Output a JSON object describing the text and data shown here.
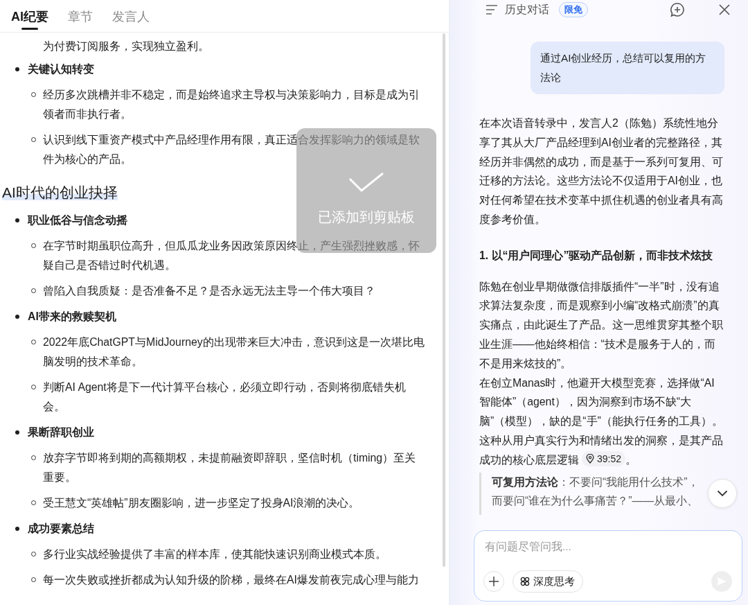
{
  "tabs": [
    {
      "label": "AI纪要",
      "selected": true
    },
    {
      "label": "章节",
      "selected": false
    },
    {
      "label": "发言人",
      "selected": false
    }
  ],
  "summary": [
    {
      "kind": "continuation",
      "text": "为付费订阅服务，实现独立盈利。"
    },
    {
      "kind": "bullet",
      "text": "关键认知转变",
      "children": [
        {
          "text": "经历多次跳槽并非不稳定，而是始终追求主导权与决策影响力，目标是成为引领者而非执行者。"
        },
        {
          "text": "认识到线下重资产模式中产品经理作用有限，真正适合发挥影响力的领域是软件为核心的产品。"
        }
      ]
    },
    {
      "kind": "heading",
      "text": "AI时代的创业抉择"
    },
    {
      "kind": "bullet",
      "text": "职业低谷与信念动摇",
      "children": [
        {
          "text": "在字节时期虽职位高升，但瓜瓜龙业务因政策原因终止，产生强烈挫败感，怀疑自己是否错过时代机遇。"
        },
        {
          "text": "曾陷入自我质疑：是否准备不足？是否永远无法主导一个伟大项目？"
        }
      ]
    },
    {
      "kind": "bullet",
      "text": "AI带来的救赎契机",
      "children": [
        {
          "text": "2022年底ChatGPT与MidJourney的出现带来巨大冲击，意识到这是一次堪比电脑发明的技术革命。"
        },
        {
          "text": "判断AI Agent将是下一代计算平台核心，必须立即行动，否则将彻底错失机会。"
        }
      ]
    },
    {
      "kind": "bullet",
      "text": "果断辞职创业",
      "children": [
        {
          "text": "放弃字节即将到期的高额期权，未提前融资即辞职，坚信时机（timing）至关重要。"
        },
        {
          "text": "受王慧文“英雄帖”朋友圈影响，进一步坚定了投身AI浪潮的决心。"
        }
      ]
    },
    {
      "kind": "bullet",
      "text": "成功要素总结",
      "children": [
        {
          "text": "多行业实战经验提供了丰富的样本库，使其能快速识别商业模式本质。"
        },
        {
          "text": "每一次失败或挫折都成为认知升级的阶梯，最终在AI爆发前夜完成心理与能力"
        }
      ]
    }
  ],
  "toast": {
    "text": "已添加到剪贴板"
  },
  "chat": {
    "title": "历史对话",
    "badge": "限免",
    "user_message": "通过AI创业经历，总结可以复用的方法论",
    "answer": [
      {
        "kind": "para",
        "lines": [
          "在本次语音转录中，发言人2（陈勉）系统性地分享了其从大厂产品经理到AI创业者的完整路径，其经历并非偶然的成功，而是基于一系列可复用、可迁移的方法论。这些方法论不仅适用于AI创业，也对任何希望在技术变革中抓住机遇的创业者具有高度参考价值。"
        ]
      },
      {
        "kind": "heading",
        "lines": [
          "1. 以“用户同理心”驱动产品创新，而非技术炫技"
        ]
      },
      {
        "kind": "para",
        "lines": [
          "陈勉在创业早期做微信排版插件“一半”时，没有追求算法复杂度，而是观察到小编“改格式崩溃”的真实痛点，由此诞生了产品。这一思维贯穿其整个职业生涯——他始终相信：“技术是服务于人的，而不是用来炫技的”。",
          "在创立Manas时，他避开大模型竞赛，选择做“AI智能体”（agent），因为洞察到市场不缺“大脑”（模型），缺的是“手”（能执行任务的工具）。这种从用户真实行为和情绪出发的洞察，是其产品成功的核心底层逻辑"
        ],
        "timestamp": "39:52",
        "tail": "。"
      },
      {
        "kind": "quote",
        "lines": [
          "**可复用方法论**：不要问“我能用什么技术”，",
          "而要问“谁在为什么事痛苦？”——从最小、"
        ]
      }
    ],
    "input": {
      "placeholder": "有问题尽管问我...",
      "mode_label": "深度思考",
      "send_disabled": true
    }
  }
}
